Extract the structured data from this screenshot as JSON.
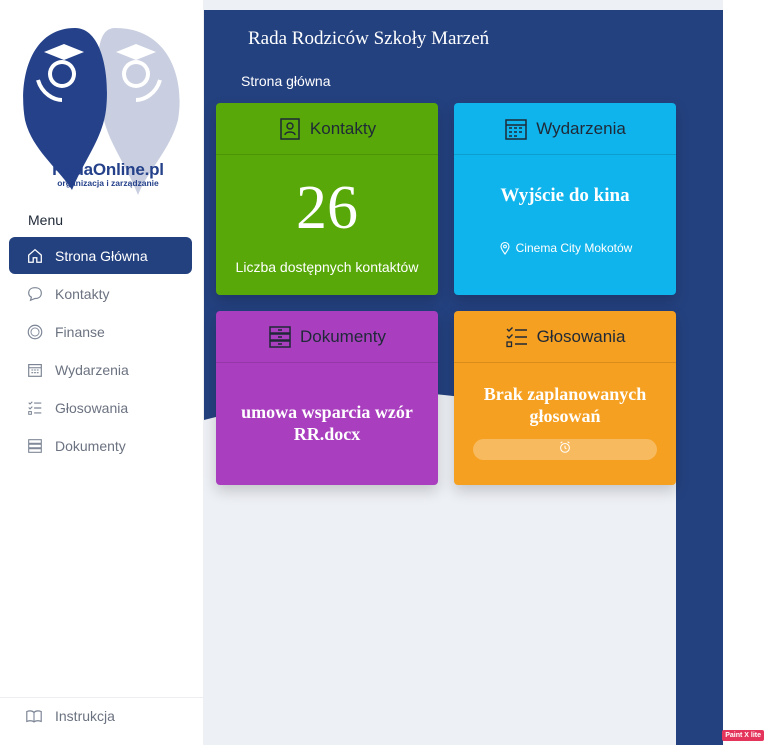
{
  "app": {
    "title": "Rada Rodziców Szkoły Marzeń",
    "breadcrumb": "Strona główna"
  },
  "logo": {
    "brand": "RadaOnline.pl",
    "tagline": "organizacja i zarządzanie",
    "colors": {
      "primary": "#24418a",
      "secondary": "#c9cfe0"
    }
  },
  "sidebar": {
    "menu_title": "Menu",
    "items": [
      {
        "label": "Strona Główna",
        "icon": "home-icon",
        "active": true
      },
      {
        "label": "Kontakty",
        "icon": "chat-icon",
        "active": false
      },
      {
        "label": "Finanse",
        "icon": "coin-icon",
        "active": false
      },
      {
        "label": "Wydarzenia",
        "icon": "calendar-icon",
        "active": false
      },
      {
        "label": "Głosowania",
        "icon": "checklist-icon",
        "active": false
      },
      {
        "label": "Dokumenty",
        "icon": "archive-icon",
        "active": false
      }
    ],
    "footer_item": {
      "label": "Instrukcja",
      "icon": "book-icon"
    }
  },
  "cards": {
    "kontakty": {
      "title": "Kontakty",
      "value": "26",
      "caption": "Liczba dostępnych kontaktów",
      "color": "#57a808",
      "icon": "contact-card-icon"
    },
    "wydarzenia": {
      "title": "Wydarzenia",
      "event": "Wyjście do kina",
      "place": "Cinema City Mokotów",
      "color": "#0fb4ec",
      "icon": "calendar-icon"
    },
    "dokumenty": {
      "title": "Dokumenty",
      "document": "umowa wsparcia wzór RR.docx",
      "color": "#a93fbf",
      "icon": "archive-icon"
    },
    "glosowania": {
      "title": "Głosowania",
      "status": "Brak zaplanowanych głosowań",
      "color": "#f5a020",
      "icon": "checklist-icon"
    }
  },
  "theme": {
    "primary": "#24417f",
    "background": "#edf0f5"
  },
  "badge": "Paint X lite"
}
